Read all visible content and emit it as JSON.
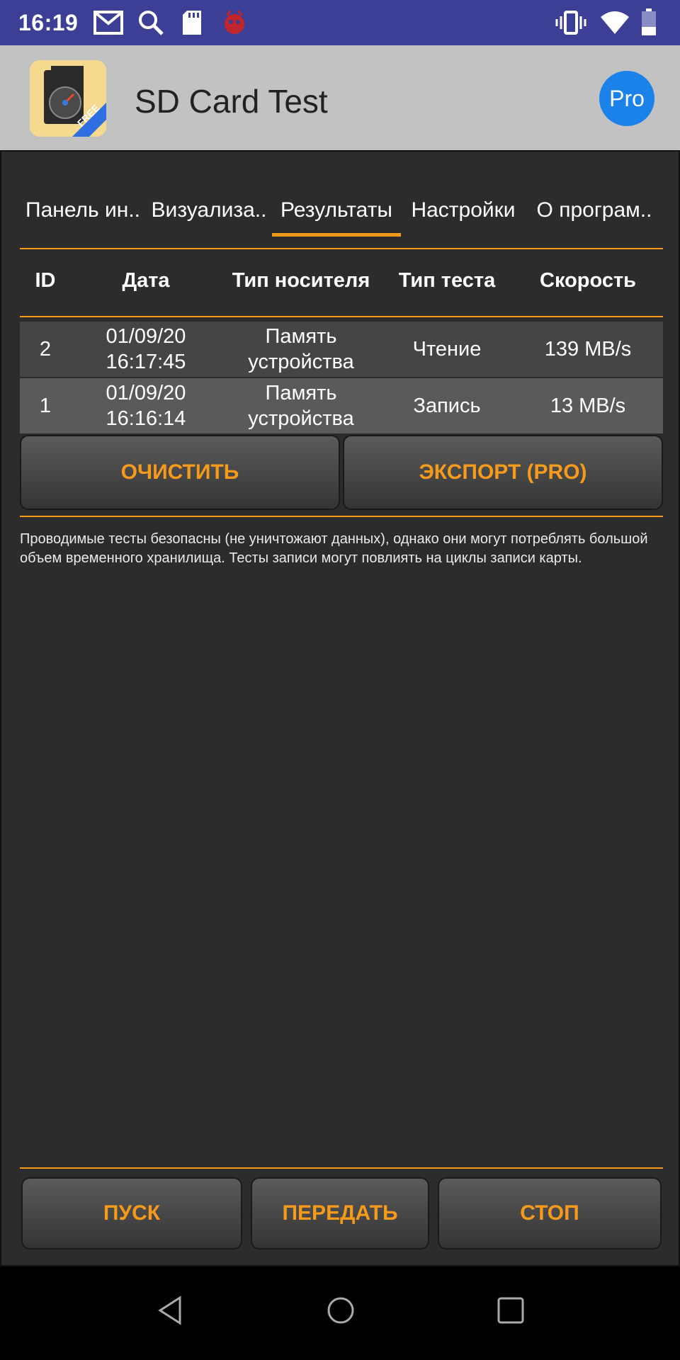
{
  "status_bar": {
    "time": "16:19"
  },
  "app_bar": {
    "title": "SD Card Test",
    "pro_label": "Pro",
    "logo_badge": "FREE"
  },
  "tabs": [
    {
      "label": "Панель ин.."
    },
    {
      "label": "Визуализа.."
    },
    {
      "label": "Результаты"
    },
    {
      "label": "Настройки"
    },
    {
      "label": "О програм.."
    }
  ],
  "active_tab": "Результаты",
  "table": {
    "headers": [
      "ID",
      "Дата",
      "Тип носителя",
      "Тип теста",
      "Скорость"
    ],
    "rows": [
      {
        "id": "2",
        "date": "01/09/20",
        "time": "16:17:45",
        "media_line1": "Память",
        "media_line2": "устройства",
        "test": "Чтение",
        "speed": "139 MB/s"
      },
      {
        "id": "1",
        "date": "01/09/20",
        "time": "16:16:14",
        "media_line1": "Память",
        "media_line2": "устройства",
        "test": "Запись",
        "speed": "13 MB/s"
      }
    ]
  },
  "buttons": {
    "clear": "ОЧИСТИТЬ",
    "export": "ЭКСПОРТ (PRO)",
    "start": "ПУСК",
    "send": "ПЕРЕДАТЬ",
    "stop": "СТОП"
  },
  "note": "Проводимые тесты безопасны (не уничтожают данных), однако они могут потреблять большой объем временного хранилища. Тесты записи могут повлиять на циклы записи карты.",
  "colors": {
    "accent": "#f59a1b",
    "status_bar": "#3c3f95",
    "pro": "#1a82e8"
  }
}
